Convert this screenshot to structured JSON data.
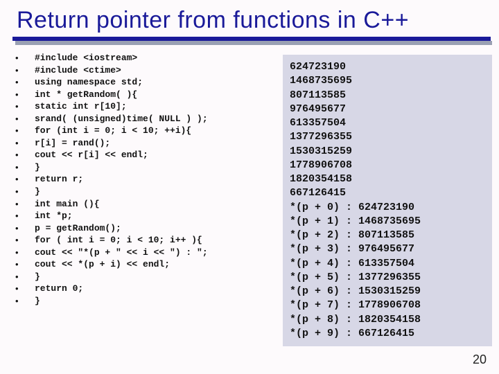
{
  "title": "Return pointer from functions in C++",
  "code_lines": [
    "#include <iostream>",
    "#include <ctime>",
    "using namespace std;",
    "int * getRandom( ){",
    "static int r[10];",
    "srand( (unsigned)time( NULL ) );",
    "for (int i = 0; i < 10; ++i){",
    "r[i] = rand();",
    "cout << r[i] << endl;",
    "}",
    "return r;",
    "}",
    "int main (){",
    "int *p;",
    "p = getRandom();",
    "for ( int i = 0; i < 10; i++ ){",
    "cout << \"*(p + \" << i << \") : \";",
    "cout << *(p + i) << endl;",
    "}",
    "return 0;",
    "}"
  ],
  "output_lines": [
    "624723190",
    "1468735695",
    "807113585",
    "976495677",
    "613357504",
    "1377296355",
    "1530315259",
    "1778906708",
    "1820354158",
    "667126415",
    "*(p + 0) : 624723190",
    "*(p + 1) : 1468735695",
    "*(p + 2) : 807113585",
    "*(p + 3) : 976495677",
    "*(p + 4) : 613357504",
    "*(p + 5) : 1377296355",
    "*(p + 6) : 1530315259",
    "*(p + 7) : 1778906708",
    "*(p + 8) : 1820354158",
    "*(p + 9) : 667126415"
  ],
  "page_number": "20"
}
